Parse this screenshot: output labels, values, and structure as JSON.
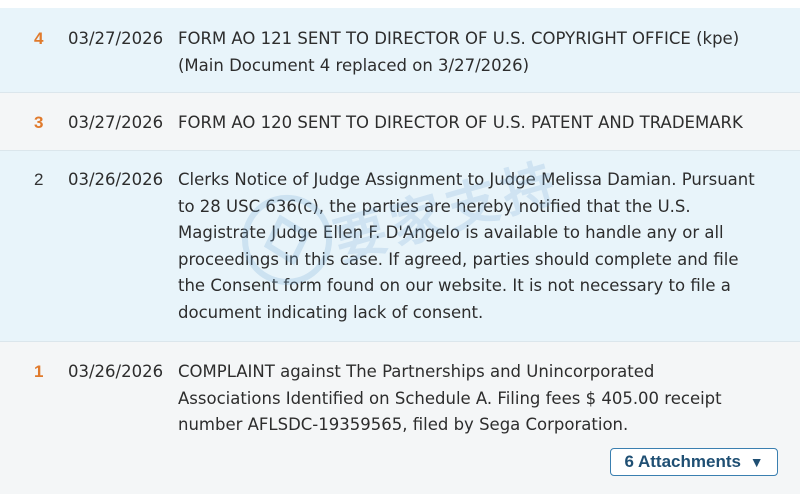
{
  "entries": [
    {
      "number": "4",
      "date": "03/27/2026",
      "lines": [
        "FORM AO 121 SENT TO DIRECTOR OF U.S. COPYRIGHT OFFICE (kpe)",
        "(Main Document 4 replaced on 3/27/2026)"
      ]
    },
    {
      "number": "3",
      "date": "03/27/2026",
      "lines": [
        "FORM AO 120 SENT TO DIRECTOR OF U.S. PATENT AND TRADEMARK"
      ]
    },
    {
      "number": "2",
      "date": "03/26/2026",
      "lines": [
        "Clerks Notice of Judge Assignment to Judge Melissa Damian. Pursuant",
        "to 28 USC 636(c), the parties are hereby notified that the U.S.",
        "Magistrate Judge Ellen F. D'Angelo is available to handle any or all",
        "proceedings in this case. If agreed, parties should complete and file",
        "the Consent form found on our website. It is not necessary to file a",
        "document indicating lack of consent."
      ]
    },
    {
      "number": "1",
      "date": "03/26/2026",
      "lines": [
        "COMPLAINT against The Partnerships and Unincorporated",
        "Associations Identified on Schedule A. Filing fees $ 405.00 receipt",
        "number AFLSDC-19359565, filed by Sega Corporation."
      ],
      "attachments_label": "6 Attachments",
      "attachments_caret": "▼"
    }
  ],
  "watermark": {
    "text": "要家支持"
  },
  "colors": {
    "accent_number": "#e07a2c",
    "row_blue": "#e8f4fa",
    "row_light": "#f4f6f7",
    "button_border": "#3a7fb0"
  }
}
